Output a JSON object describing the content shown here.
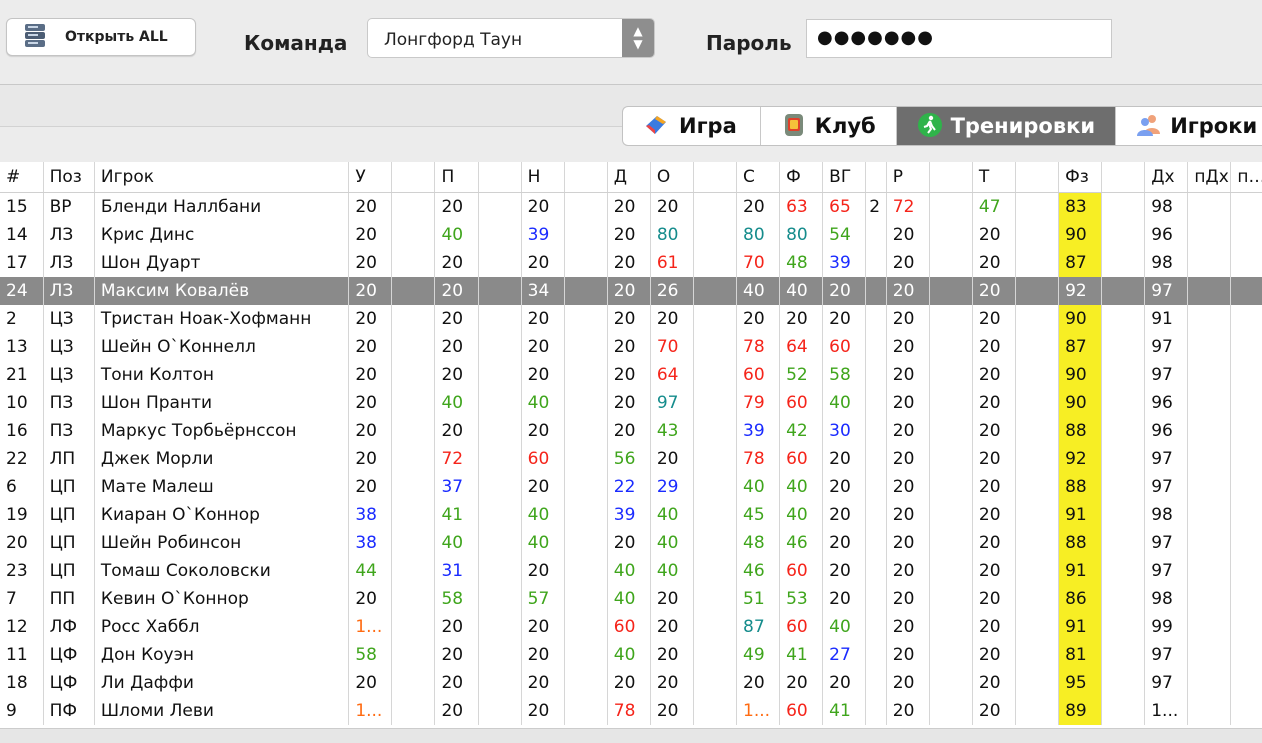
{
  "toolbar": {
    "open_button_label": "Открыть ALL",
    "team_label": "Команда",
    "team_value": "Лонгфорд Таун",
    "password_label": "Пароль",
    "password_value": "●●●●●●●"
  },
  "tabs": [
    {
      "label": "Игра",
      "icon": "game-icon",
      "active": false
    },
    {
      "label": "Клуб",
      "icon": "club-icon",
      "active": false
    },
    {
      "label": "Тренировки",
      "icon": "training-icon",
      "active": true
    },
    {
      "label": "Игроки",
      "icon": "players-icon",
      "active": false
    }
  ],
  "colors": {
    "red": "#f5241a",
    "green": "#3fa51c",
    "blue": "#1a2bff",
    "teal": "#158c8c",
    "orange": "#ff6b12",
    "highlight": "#f7ee24",
    "selected_row": "#8a8a8a"
  },
  "table": {
    "columns": [
      "#",
      "Поз",
      "Игрок",
      "У",
      "",
      "П",
      "",
      "Н",
      "",
      "Д",
      "О",
      "",
      "С",
      "Ф",
      "ВГ",
      "",
      "Р",
      "",
      "Т",
      "",
      "Фз",
      "",
      "Дх",
      "пДх",
      "пФз"
    ],
    "rows": [
      {
        "num": "15",
        "pos": "ВР",
        "name": "Бленди Наллбани",
        "u": "20",
        "p": "20",
        "n": "20",
        "d": "20",
        "o": "20",
        "s": "20",
        "f": "63",
        "vg": "65",
        "vg2": "2",
        "r": "72",
        "t": "47",
        "fz": "83",
        "dh": "98",
        "colors": {
          "f": "red",
          "vg": "red",
          "r": "red",
          "t": "green"
        }
      },
      {
        "num": "14",
        "pos": "ЛЗ",
        "name": "Крис Динс",
        "u": "20",
        "p": "40",
        "n": "39",
        "d": "20",
        "o": "80",
        "s": "80",
        "f": "80",
        "vg": "54",
        "vg2": "",
        "r": "20",
        "t": "20",
        "fz": "90",
        "dh": "96",
        "colors": {
          "p": "green",
          "n": "blue",
          "o": "teal",
          "s": "teal",
          "f": "teal",
          "vg": "green"
        }
      },
      {
        "num": "17",
        "pos": "ЛЗ",
        "name": "Шон Дуарт",
        "u": "20",
        "p": "20",
        "n": "20",
        "d": "20",
        "o": "61",
        "s": "70",
        "f": "48",
        "vg": "39",
        "vg2": "",
        "r": "20",
        "t": "20",
        "fz": "87",
        "dh": "98",
        "colors": {
          "o": "red",
          "s": "red",
          "f": "green",
          "vg": "blue"
        }
      },
      {
        "num": "24",
        "pos": "ЛЗ",
        "name": "Максим Ковалёв",
        "u": "20",
        "p": "20",
        "n": "34",
        "d": "20",
        "o": "26",
        "s": "40",
        "f": "40",
        "vg": "20",
        "vg2": "",
        "r": "20",
        "t": "20",
        "fz": "92",
        "dh": "97",
        "selected": true,
        "colors": {}
      },
      {
        "num": "2",
        "pos": "ЦЗ",
        "name": "Тристан Ноак-Хофманн",
        "u": "20",
        "p": "20",
        "n": "20",
        "d": "20",
        "o": "20",
        "s": "20",
        "f": "20",
        "vg": "20",
        "vg2": "",
        "r": "20",
        "t": "20",
        "fz": "90",
        "dh": "91",
        "colors": {}
      },
      {
        "num": "13",
        "pos": "ЦЗ",
        "name": "Шейн О`Коннелл",
        "u": "20",
        "p": "20",
        "n": "20",
        "d": "20",
        "o": "70",
        "s": "78",
        "f": "64",
        "vg": "60",
        "vg2": "",
        "r": "20",
        "t": "20",
        "fz": "87",
        "dh": "97",
        "colors": {
          "o": "red",
          "s": "red",
          "f": "red",
          "vg": "red"
        }
      },
      {
        "num": "21",
        "pos": "ЦЗ",
        "name": "Тони Колтон",
        "u": "20",
        "p": "20",
        "n": "20",
        "d": "20",
        "o": "64",
        "s": "60",
        "f": "52",
        "vg": "58",
        "vg2": "",
        "r": "20",
        "t": "20",
        "fz": "90",
        "dh": "97",
        "colors": {
          "o": "red",
          "s": "red",
          "f": "green",
          "vg": "green"
        }
      },
      {
        "num": "10",
        "pos": "ПЗ",
        "name": "Шон Пранти",
        "u": "20",
        "p": "40",
        "n": "40",
        "d": "20",
        "o": "97",
        "s": "79",
        "f": "60",
        "vg": "40",
        "vg2": "",
        "r": "20",
        "t": "20",
        "fz": "90",
        "dh": "96",
        "colors": {
          "p": "green",
          "n": "green",
          "o": "teal",
          "s": "red",
          "f": "red",
          "vg": "green"
        }
      },
      {
        "num": "16",
        "pos": "ПЗ",
        "name": "Маркус Торбьёрнссон",
        "u": "20",
        "p": "20",
        "n": "20",
        "d": "20",
        "o": "43",
        "s": "39",
        "f": "42",
        "vg": "30",
        "vg2": "",
        "r": "20",
        "t": "20",
        "fz": "88",
        "dh": "96",
        "colors": {
          "o": "green",
          "s": "blue",
          "f": "green",
          "vg": "blue"
        }
      },
      {
        "num": "22",
        "pos": "ЛП",
        "name": "Джек Морли",
        "u": "20",
        "p": "72",
        "n": "60",
        "d": "56",
        "o": "20",
        "s": "78",
        "f": "60",
        "vg": "20",
        "vg2": "",
        "r": "20",
        "t": "20",
        "fz": "92",
        "dh": "97",
        "colors": {
          "p": "red",
          "n": "red",
          "d": "green",
          "s": "red",
          "f": "red"
        }
      },
      {
        "num": "6",
        "pos": "ЦП",
        "name": "Мате Малеш",
        "u": "20",
        "p": "37",
        "n": "20",
        "d": "22",
        "o": "29",
        "s": "40",
        "f": "40",
        "vg": "20",
        "vg2": "",
        "r": "20",
        "t": "20",
        "fz": "88",
        "dh": "97",
        "colors": {
          "p": "blue",
          "d": "blue",
          "o": "blue",
          "s": "green",
          "f": "green"
        }
      },
      {
        "num": "19",
        "pos": "ЦП",
        "name": "Киаран О`Коннор",
        "u": "38",
        "p": "41",
        "n": "40",
        "d": "39",
        "o": "40",
        "s": "45",
        "f": "40",
        "vg": "20",
        "vg2": "",
        "r": "20",
        "t": "20",
        "fz": "91",
        "dh": "98",
        "colors": {
          "u": "blue",
          "p": "green",
          "n": "green",
          "d": "blue",
          "o": "green",
          "s": "green",
          "f": "green"
        }
      },
      {
        "num": "20",
        "pos": "ЦП",
        "name": "Шейн Робинсон",
        "u": "38",
        "p": "40",
        "n": "40",
        "d": "20",
        "o": "40",
        "s": "48",
        "f": "46",
        "vg": "20",
        "vg2": "",
        "r": "20",
        "t": "20",
        "fz": "88",
        "dh": "97",
        "colors": {
          "u": "blue",
          "p": "green",
          "n": "green",
          "o": "green",
          "s": "green",
          "f": "green"
        }
      },
      {
        "num": "23",
        "pos": "ЦП",
        "name": "Томаш Соколовски",
        "u": "44",
        "p": "31",
        "n": "20",
        "d": "40",
        "o": "40",
        "s": "46",
        "f": "60",
        "vg": "20",
        "vg2": "",
        "r": "20",
        "t": "20",
        "fz": "91",
        "dh": "97",
        "colors": {
          "u": "green",
          "p": "blue",
          "d": "green",
          "o": "green",
          "s": "green",
          "f": "red"
        }
      },
      {
        "num": "7",
        "pos": "ПП",
        "name": "Кевин О`Коннор",
        "u": "20",
        "p": "58",
        "n": "57",
        "d": "40",
        "o": "20",
        "s": "51",
        "f": "53",
        "vg": "20",
        "vg2": "",
        "r": "20",
        "t": "20",
        "fz": "86",
        "dh": "98",
        "colors": {
          "p": "green",
          "n": "green",
          "d": "green",
          "s": "green",
          "f": "green"
        }
      },
      {
        "num": "12",
        "pos": "ЛФ",
        "name": "Росс Хаббл",
        "u": "1...",
        "p": "20",
        "n": "20",
        "d": "60",
        "o": "20",
        "s": "87",
        "f": "60",
        "vg": "40",
        "vg2": "",
        "r": "20",
        "t": "20",
        "fz": "91",
        "dh": "99",
        "colors": {
          "u": "orange",
          "d": "red",
          "s": "teal",
          "f": "red",
          "vg": "green"
        }
      },
      {
        "num": "11",
        "pos": "ЦФ",
        "name": "Дон Коуэн",
        "u": "58",
        "p": "20",
        "n": "20",
        "d": "40",
        "o": "20",
        "s": "49",
        "f": "41",
        "vg": "27",
        "vg2": "",
        "r": "20",
        "t": "20",
        "fz": "81",
        "dh": "97",
        "colors": {
          "u": "green",
          "d": "green",
          "s": "green",
          "f": "green",
          "vg": "blue"
        }
      },
      {
        "num": "18",
        "pos": "ЦФ",
        "name": "Ли Даффи",
        "u": "20",
        "p": "20",
        "n": "20",
        "d": "20",
        "o": "20",
        "s": "20",
        "f": "20",
        "vg": "20",
        "vg2": "",
        "r": "20",
        "t": "20",
        "fz": "95",
        "dh": "97",
        "colors": {}
      },
      {
        "num": "9",
        "pos": "ПФ",
        "name": "Шломи Леви",
        "u": "1...",
        "p": "20",
        "n": "20",
        "d": "78",
        "o": "20",
        "s": "1...",
        "f": "60",
        "vg": "41",
        "vg2": "",
        "r": "20",
        "t": "20",
        "fz": "89",
        "dh": "1...",
        "colors": {
          "u": "orange",
          "d": "red",
          "s": "orange",
          "f": "red",
          "vg": "green"
        }
      }
    ]
  }
}
